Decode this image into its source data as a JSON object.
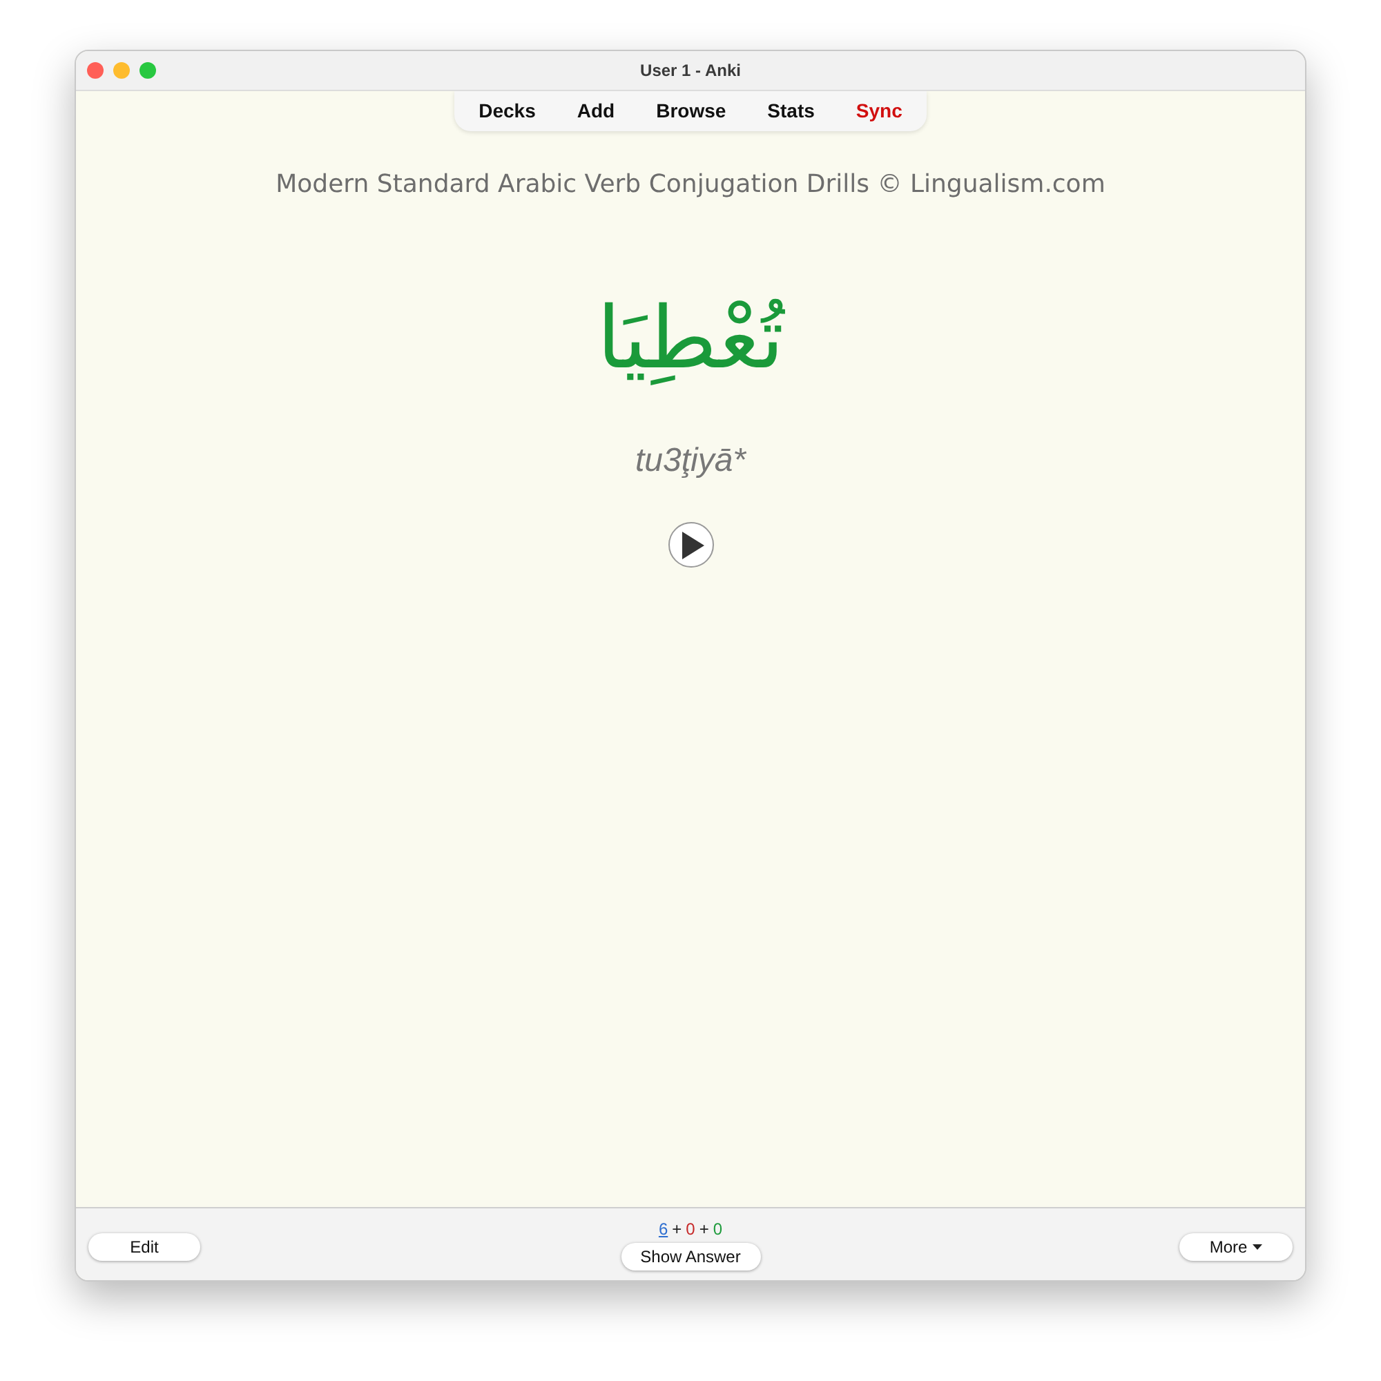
{
  "window": {
    "title": "User 1 - Anki"
  },
  "toolbar": {
    "items": [
      {
        "label": "Decks",
        "highlighted": false
      },
      {
        "label": "Add",
        "highlighted": false
      },
      {
        "label": "Browse",
        "highlighted": false
      },
      {
        "label": "Stats",
        "highlighted": false
      },
      {
        "label": "Sync",
        "highlighted": true
      }
    ]
  },
  "card": {
    "header": "Modern Standard Arabic Verb Conjugation Drills © Lingualism.com",
    "word": "تُعْطِيَا",
    "transliteration": "tu3ţiyā*"
  },
  "bottom_bar": {
    "edit_button": "Edit",
    "counts": [
      {
        "value": "6",
        "color": "#2f6fd0",
        "selected": true
      },
      {
        "separator": "+",
        "value": "0",
        "color": "#c62828",
        "selected": false
      },
      {
        "separator": "+",
        "value": "0",
        "color": "#1e9b3c",
        "selected": false
      }
    ],
    "show_answer_button": "Show Answer",
    "more_button": "More"
  }
}
